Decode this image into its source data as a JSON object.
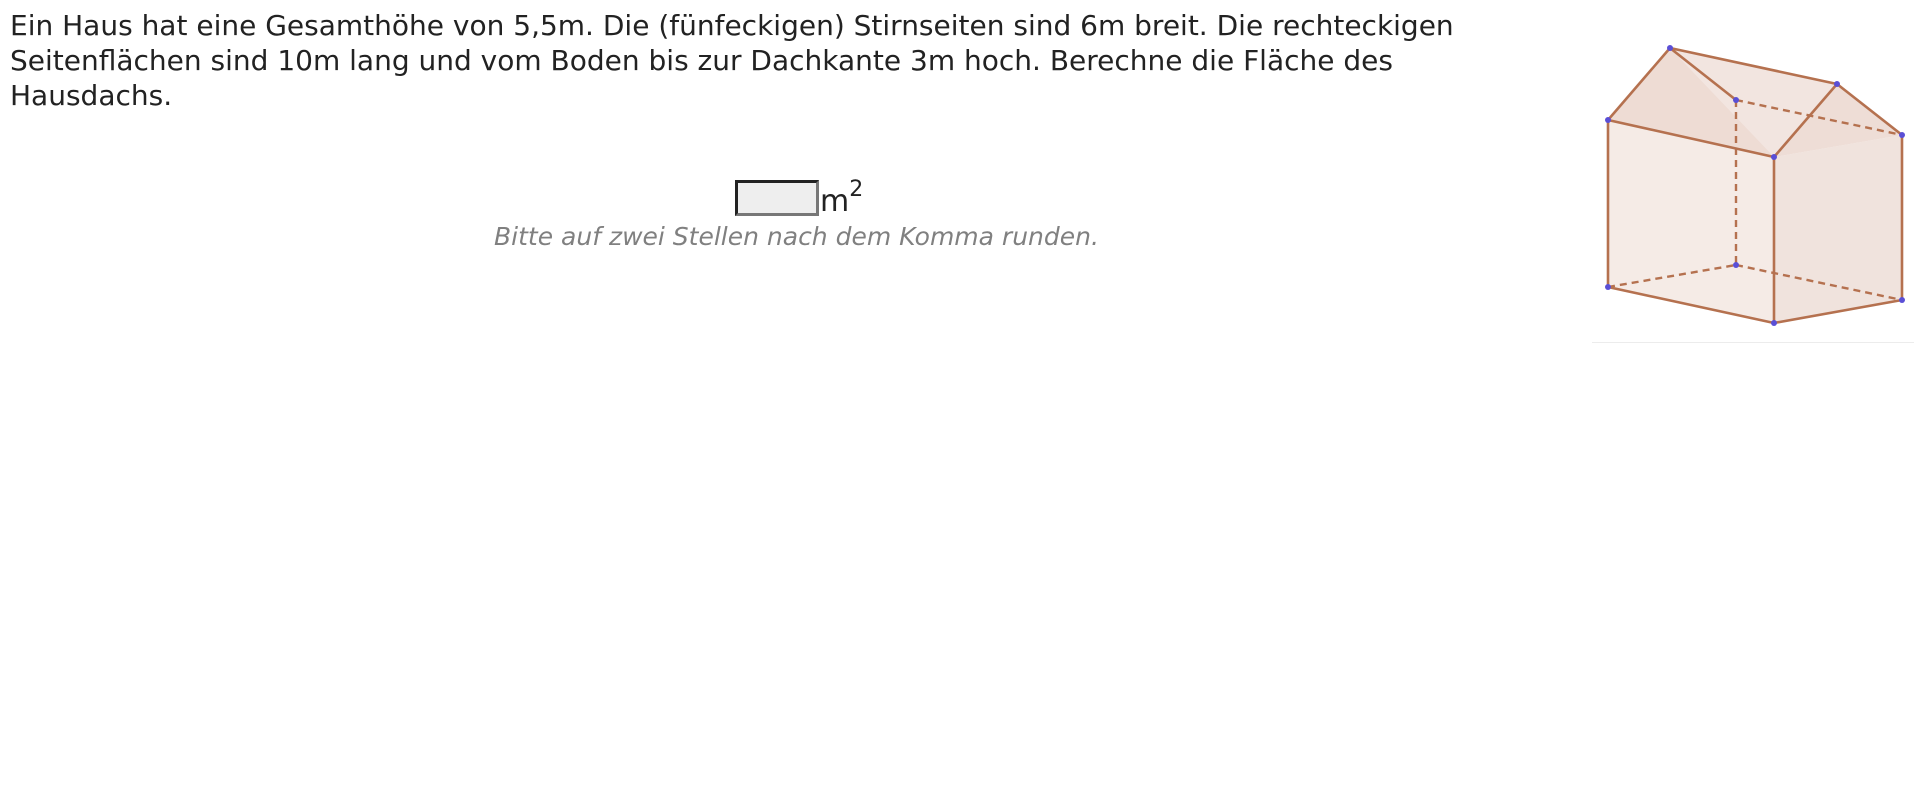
{
  "question": {
    "text": "Ein Haus hat eine Gesamthöhe von 5,5m. Die (fünfeckigen) Stirnseiten sind 6m breit. Die rechteckigen Seitenflächen sind 10m lang und vom Boden bis zur Dachkante 3m hoch. Berechne die Fläche des Hausdachs."
  },
  "answer": {
    "value": "",
    "placeholder": "",
    "unit": "m",
    "unit_exponent": "2"
  },
  "hint": "Bitte auf zwei Stellen nach dem Komma runden.",
  "figure": {
    "icon": "house-prism-illustration",
    "colors": {
      "edge": "#b5714f",
      "vertex": "#5a4fd6",
      "face": "#ecd9d0"
    }
  }
}
